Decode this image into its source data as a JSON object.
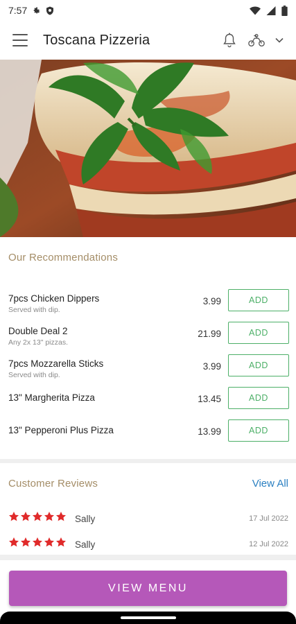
{
  "status_bar": {
    "time": "7:57"
  },
  "header": {
    "title": "Toscana Pizzeria"
  },
  "hero": {
    "alt": "lasagna with parsley"
  },
  "recommendations": {
    "title": "Our Recommendations",
    "add_label": "ADD",
    "items": [
      {
        "name": "7pcs Chicken Dippers",
        "desc": "Served with dip.",
        "price": "3.99"
      },
      {
        "name": "Double Deal 2",
        "desc": "Any 2x 13\" pizzas.",
        "price": "21.99"
      },
      {
        "name": "7pcs Mozzarella Sticks",
        "desc": "Served with dip.",
        "price": "3.99"
      },
      {
        "name": "13\" Margherita Pizza",
        "desc": "",
        "price": "13.45"
      },
      {
        "name": "13\" Pepperoni Plus Pizza",
        "desc": "",
        "price": "13.99"
      }
    ]
  },
  "reviews": {
    "title": "Customer Reviews",
    "view_all": "View All",
    "items": [
      {
        "rating": 5,
        "name": "Sally",
        "date": "17 Jul 2022"
      },
      {
        "rating": 5,
        "name": "Sally",
        "date": "12 Jul 2022"
      }
    ]
  },
  "cta": {
    "label": "VIEW MENU"
  },
  "colors": {
    "accent_purple": "#b558b9",
    "add_green": "#4caf67",
    "section_gold": "#a48d67",
    "link_blue": "#2a7fc1",
    "star_red": "#e02a2a"
  }
}
